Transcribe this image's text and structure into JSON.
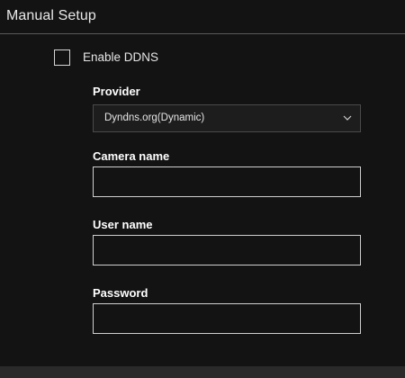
{
  "section": {
    "title": "Manual Setup"
  },
  "ddns": {
    "enable_label": "Enable DDNS",
    "enabled": false
  },
  "provider": {
    "label": "Provider",
    "selected": "Dyndns.org(Dynamic)"
  },
  "camera_name": {
    "label": "Camera name",
    "value": ""
  },
  "user_name": {
    "label": "User name",
    "value": ""
  },
  "password": {
    "label": "Password",
    "value": ""
  }
}
